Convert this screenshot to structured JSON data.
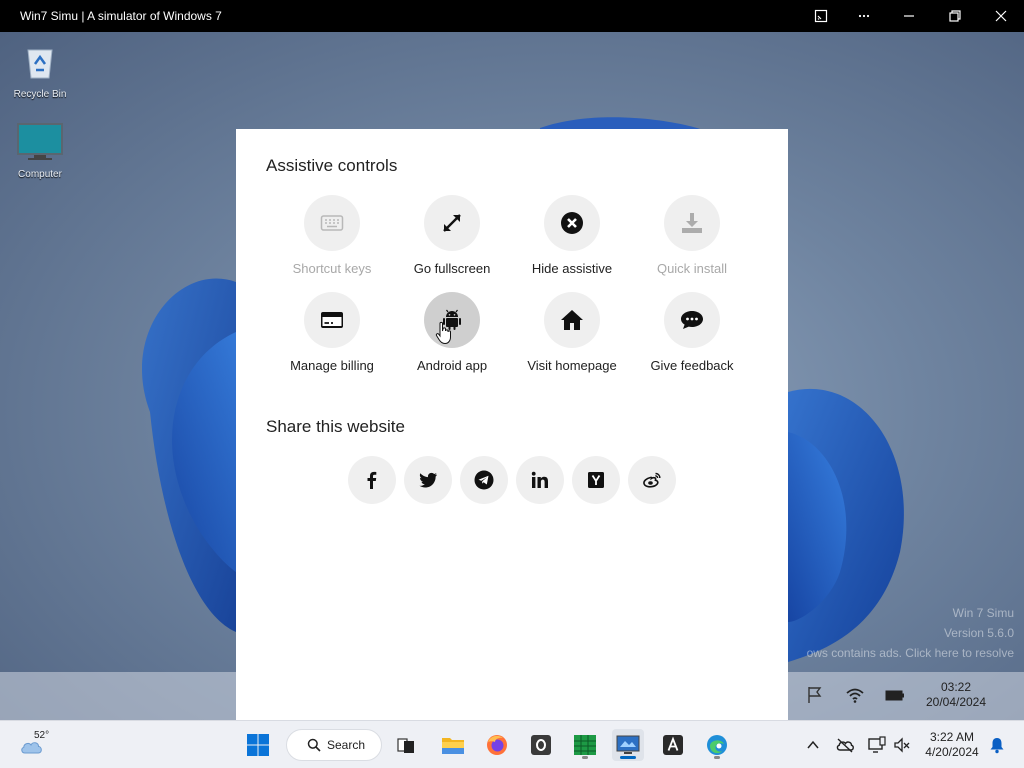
{
  "window": {
    "title": "Win7 Simu | A simulator of Windows 7"
  },
  "desktop": {
    "icons": [
      {
        "label": "Recycle Bin"
      },
      {
        "label": "Computer"
      }
    ],
    "watermark": {
      "line1": "Win 7 Simu",
      "line2": "Version 5.6.0",
      "line3": "ows contains ads. Click here to resolve"
    },
    "clock": {
      "time": "03:22",
      "date": "20/04/2024"
    }
  },
  "assistive": {
    "title": "Assistive controls",
    "controls": [
      {
        "label": "Shortcut keys",
        "icon": "keyboard-icon",
        "enabled": false
      },
      {
        "label": "Go fullscreen",
        "icon": "expand-icon",
        "enabled": true
      },
      {
        "label": "Hide assistive",
        "icon": "close-circle-icon",
        "enabled": true
      },
      {
        "label": "Quick install",
        "icon": "download-icon",
        "enabled": false
      },
      {
        "label": "Manage billing",
        "icon": "credit-card-icon",
        "enabled": true
      },
      {
        "label": "Android app",
        "icon": "android-icon",
        "enabled": true
      },
      {
        "label": "Visit homepage",
        "icon": "home-icon",
        "enabled": true
      },
      {
        "label": "Give feedback",
        "icon": "chat-icon",
        "enabled": true
      }
    ]
  },
  "share": {
    "title": "Share this website",
    "items": [
      "facebook-icon",
      "twitter-icon",
      "telegram-icon",
      "linkedin-icon",
      "hacker-news-icon",
      "weibo-icon"
    ]
  },
  "taskbar": {
    "weather": {
      "temp": "52°"
    },
    "search": {
      "label": "Search"
    },
    "clock": {
      "time": "3:22 AM",
      "date": "4/20/2024"
    }
  },
  "colors": {
    "accent": "#0067c0",
    "titlebar": "#000000",
    "disabled": "#a8a8a8"
  }
}
